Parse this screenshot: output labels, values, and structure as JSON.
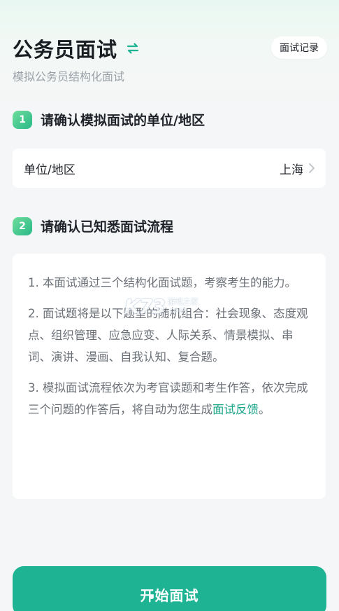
{
  "header": {
    "title": "公务员面试",
    "swap_icon": "swap-arrows-icon",
    "record_label": "面试记录",
    "subtitle": "模拟公务员结构化面试"
  },
  "steps": [
    {
      "number": "1",
      "text": "请确认模拟面试的单位/地区"
    },
    {
      "number": "2",
      "text": "请确认已知悉面试流程"
    }
  ],
  "unit": {
    "label": "单位/地区",
    "value": "上海",
    "chevron_icon": "chevron-right-icon"
  },
  "info": {
    "para1": "1. 本面试通过三个结构化面试题，考察考生的能力。",
    "para2": "2. 面试题将是以下题型的随机组合：社会现象、态度观点、组织管理、应急应变、人际关系、情景模拟、串词、演讲、漫画、自我认知、复合题。",
    "para3_prefix": "3. 模拟面试流程依次为考官读题和考生作答，依次完成三个问题的作答后，将自动为您生成",
    "para3_link": "面试反馈",
    "para3_suffix": "。"
  },
  "watermark": {
    "logo": "K73",
    "text_line1": "游戏之家",
    "text_line2": ".com"
  },
  "start_button": {
    "label": "开始面试"
  },
  "colors": {
    "accent": "#1db393",
    "link": "#1aa58a",
    "badge_start": "#6fdc9b",
    "badge_end": "#28b988",
    "muted_text": "#6b7077",
    "subtitle_text": "#9aa0a6"
  }
}
